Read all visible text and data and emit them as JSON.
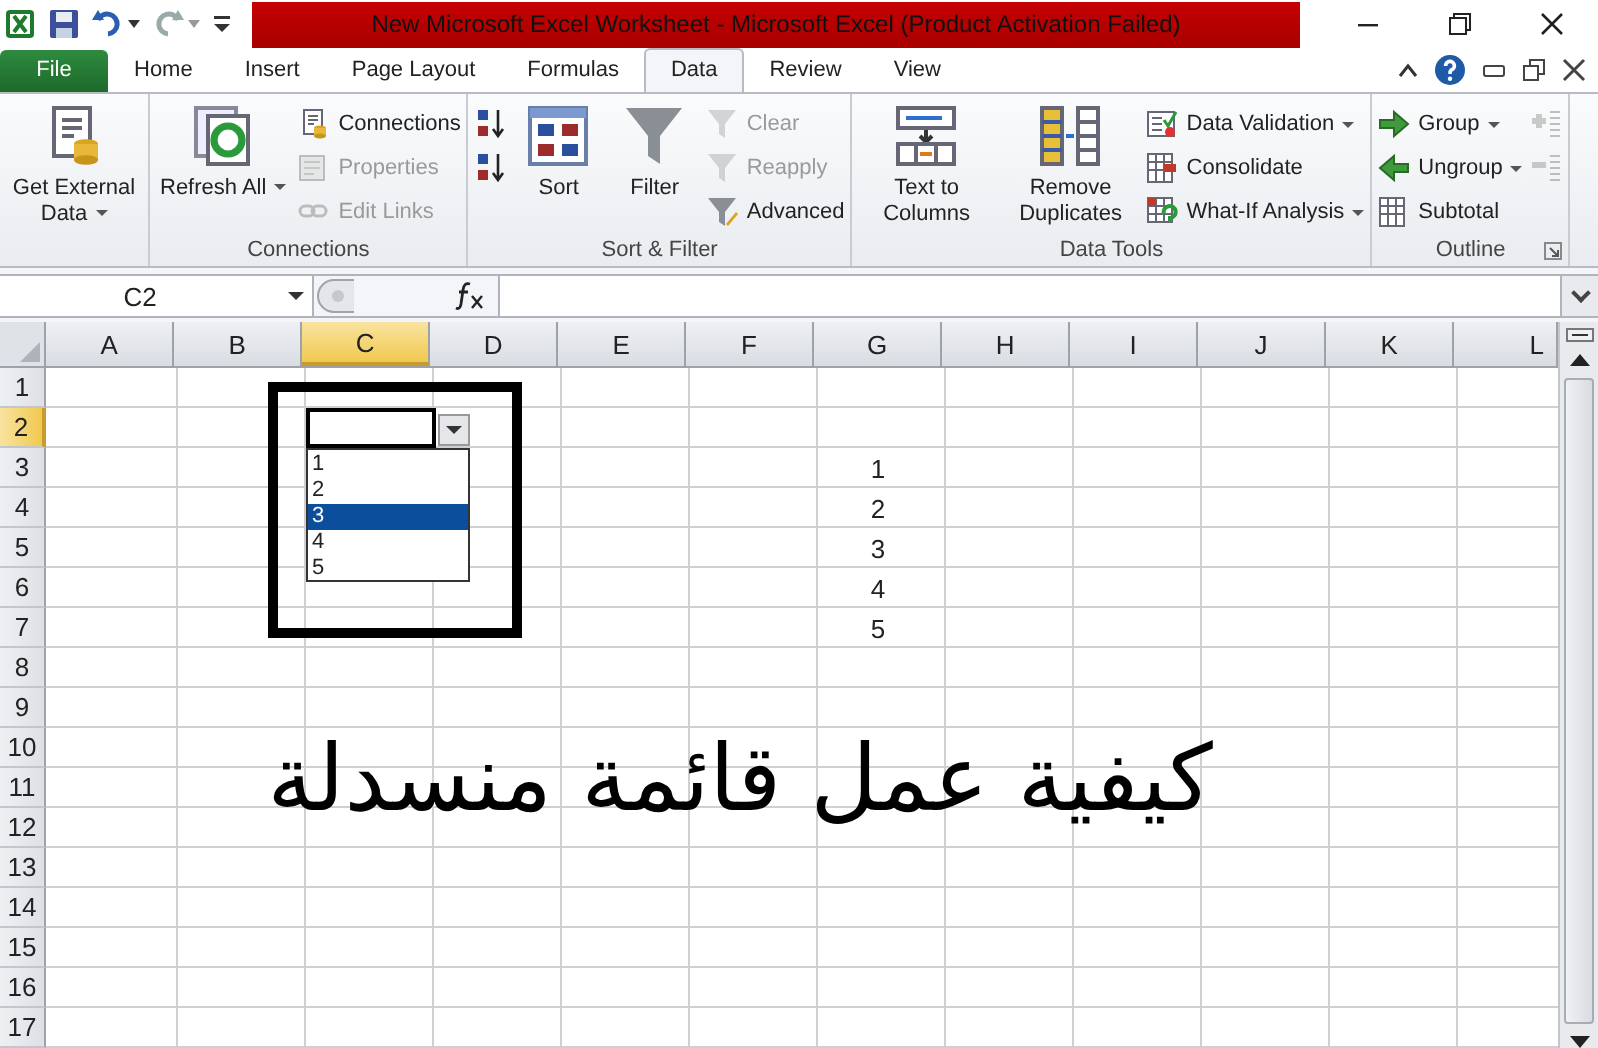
{
  "window": {
    "title": "New Microsoft Excel Worksheet  -  Microsoft Excel (Product Activation Failed)"
  },
  "tabs": [
    {
      "label": "File",
      "kind": "file",
      "selected": false
    },
    {
      "label": "Home",
      "kind": "tab",
      "selected": false
    },
    {
      "label": "Insert",
      "kind": "tab",
      "selected": false
    },
    {
      "label": "Page Layout",
      "kind": "tab",
      "selected": false
    },
    {
      "label": "Formulas",
      "kind": "tab",
      "selected": false
    },
    {
      "label": "Data",
      "kind": "tab",
      "selected": true
    },
    {
      "label": "Review",
      "kind": "tab",
      "selected": false
    },
    {
      "label": "View",
      "kind": "tab",
      "selected": false
    }
  ],
  "ribbon": {
    "groups": [
      {
        "columns": [
          [
            {
              "label": "Get External Data",
              "kind": "large",
              "menu": true,
              "disabled": false
            }
          ]
        ]
      },
      {
        "label": "Connections",
        "columns": [
          [
            {
              "label": "Refresh All",
              "kind": "large",
              "menu": true,
              "disabled": false
            }
          ],
          [
            {
              "label": "Connections",
              "kind": "small",
              "menu": false,
              "disabled": false
            },
            {
              "label": "Properties",
              "kind": "small",
              "menu": false,
              "disabled": true
            },
            {
              "label": "Edit Links",
              "kind": "small",
              "menu": false,
              "disabled": true
            }
          ]
        ]
      },
      {
        "label": "Sort & Filter",
        "columns": [
          [
            {
              "kind": "small",
              "disabled": false
            },
            {
              "kind": "small",
              "disabled": false
            }
          ],
          [
            {
              "label": "Sort",
              "kind": "large",
              "menu": false,
              "disabled": false
            }
          ],
          [
            {
              "label": "Filter",
              "kind": "large",
              "menu": false,
              "disabled": false
            }
          ],
          [
            {
              "label": "Clear",
              "kind": "small",
              "menu": false,
              "disabled": true
            },
            {
              "label": "Reapply",
              "kind": "small",
              "menu": false,
              "disabled": true
            },
            {
              "label": "Advanced",
              "kind": "small",
              "menu": false,
              "disabled": false
            }
          ]
        ]
      },
      {
        "label": "Data Tools",
        "columns": [
          [
            {
              "label": "Text to Columns",
              "kind": "large",
              "menu": false,
              "disabled": false
            }
          ],
          [
            {
              "label": "Remove Duplicates",
              "kind": "large",
              "menu": false,
              "disabled": false
            }
          ],
          [
            {
              "label": "Data Validation",
              "kind": "small",
              "menu": true,
              "disabled": false
            },
            {
              "label": "Consolidate",
              "kind": "small",
              "menu": false,
              "disabled": false
            },
            {
              "label": "What-If Analysis",
              "kind": "small",
              "menu": true,
              "disabled": false
            }
          ]
        ]
      },
      {
        "label": "Outline",
        "launcher": true,
        "columns": [
          [
            {
              "label": "Group",
              "kind": "small",
              "menu": true,
              "disabled": false
            },
            {
              "label": "Ungroup",
              "kind": "small",
              "menu": true,
              "disabled": false
            },
            {
              "label": "Subtotal",
              "kind": "small",
              "menu": false,
              "disabled": false
            }
          ],
          [
            {
              "kind": "small",
              "disabled": true
            },
            {
              "kind": "small",
              "disabled": true
            }
          ]
        ]
      }
    ]
  },
  "formula_bar": {
    "name_box": "C2"
  },
  "sheet": {
    "columns": [
      {
        "label": "A",
        "selected": false
      },
      {
        "label": "B",
        "selected": false
      },
      {
        "label": "C",
        "selected": true
      },
      {
        "label": "D",
        "selected": false
      },
      {
        "label": "E",
        "selected": false
      },
      {
        "label": "F",
        "selected": false
      },
      {
        "label": "G",
        "selected": false
      },
      {
        "label": "H",
        "selected": false
      },
      {
        "label": "I",
        "selected": false
      },
      {
        "label": "J",
        "selected": false
      },
      {
        "label": "K",
        "selected": false
      },
      {
        "label": "L",
        "selected": false
      }
    ],
    "rows": [
      {
        "label": "1",
        "selected": false
      },
      {
        "label": "2",
        "selected": true
      },
      {
        "label": "3",
        "selected": false,
        "column_g": "1"
      },
      {
        "label": "4",
        "selected": false,
        "column_g": "2"
      },
      {
        "label": "5",
        "selected": false,
        "column_g": "3"
      },
      {
        "label": "6",
        "selected": false,
        "column_g": "4"
      },
      {
        "label": "7",
        "selected": false,
        "column_g": "5"
      },
      {
        "label": "8",
        "selected": false
      },
      {
        "label": "9",
        "selected": false
      },
      {
        "label": "10",
        "selected": false
      },
      {
        "label": "11",
        "selected": false
      },
      {
        "label": "12",
        "selected": false
      },
      {
        "label": "13",
        "selected": false
      },
      {
        "label": "14",
        "selected": false
      },
      {
        "label": "15",
        "selected": false
      },
      {
        "label": "16",
        "selected": false
      },
      {
        "label": "17",
        "selected": false
      }
    ]
  },
  "dropdown": {
    "items": [
      {
        "label": "1",
        "selected": false
      },
      {
        "label": "2",
        "selected": false
      },
      {
        "label": "3",
        "selected": true
      },
      {
        "label": "4",
        "selected": false
      },
      {
        "label": "5",
        "selected": false
      }
    ]
  },
  "caption": "كيفية عمل قائمة منسدلة"
}
